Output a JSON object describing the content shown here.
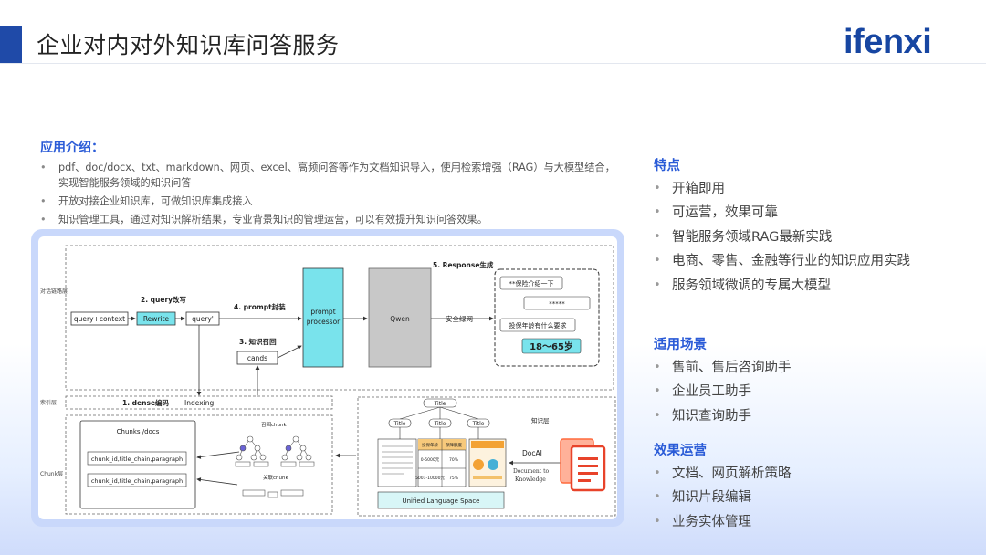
{
  "header": {
    "title": "企业对内对外知识库问答服务",
    "logo_text": "ifenxi"
  },
  "intro": {
    "title": "应用介绍：",
    "bullets": [
      "pdf、doc/docx、txt、markdown、网页、excel、高频问答等作为文档知识导入，使用检索增强（RAG）与大模型结合，实现智能服务领域的知识问答",
      "开放对接企业知识库，可做知识库集成接入",
      "知识管理工具，通过对知识解析结果，专业背景知识的管理运营，可以有效提升知识问答效果。"
    ]
  },
  "diagram": {
    "layer_dialog": "对话链路层",
    "layer_index": "索引层",
    "layer_chunk": "Chunk层",
    "query_context": "query+context",
    "rewrite": "Rewrite",
    "query_prime": "query'",
    "step2": "2. query改写",
    "step4": "4. prompt封装",
    "step3": "3. 知识召回",
    "cands": "cands",
    "prompt_processor": "prompt processor",
    "qwen": "Qwen",
    "safety": "安全绿网",
    "step5": "5. Response生成",
    "resp_line1": "**保险介绍一下",
    "resp_line2": "*****",
    "resp_line3": "投保年龄有什么要求",
    "resp_answer": "18～65岁",
    "step1": "1. dense编码",
    "indexing": "Indexing",
    "chunks_title": "Chunks /docs",
    "chunk_item_1": "chunk_id,title_chain,paragraph",
    "chunk_item_2": "chunk_id,title_chain,paragraph",
    "recall_chunk": "召回chunk",
    "link_chunk": "关联chunk",
    "kb_title_root": "Title",
    "kb_title_1": "Title",
    "kb_title_2": "Title",
    "kb_title_3": "Title",
    "kb_layer": "知识层",
    "docai": "DocAI",
    "doc_knowledge": "Document to Knowledge",
    "unified_space": "Unified Language Space",
    "table_h1": "投保年龄",
    "table_h2": "保障额度",
    "table_r1c1": "0-5000元",
    "table_r1c2": "70%",
    "table_r2c1": "5001-10000元",
    "table_r2c2": "75%"
  },
  "features": {
    "title": "特点",
    "items": [
      "开箱即用",
      "可运营，效果可靠",
      "智能服务领域RAG最新实践",
      "电商、零售、金融等行业的知识应用实践",
      "服务领域微调的专属大模型"
    ]
  },
  "scenarios": {
    "title": "适用场景",
    "items": [
      "售前、售后咨询助手",
      "企业员工助手",
      "知识查询助手"
    ]
  },
  "operations": {
    "title": "效果运营",
    "items": [
      "文档、网页解析策略",
      "知识片段编辑",
      "业务实体管理"
    ]
  }
}
